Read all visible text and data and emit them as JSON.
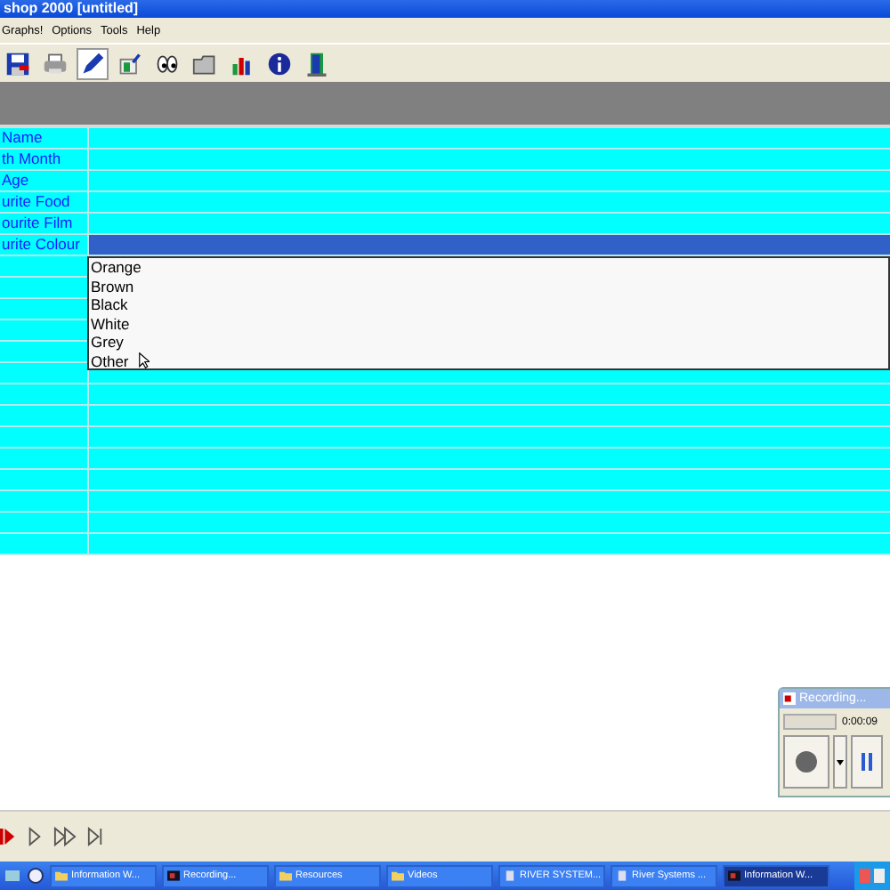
{
  "window": {
    "title": "shop 2000 [untitled]"
  },
  "menu": [
    {
      "label": "Graphs!"
    },
    {
      "label": "Options"
    },
    {
      "label": "Tools"
    },
    {
      "label": "Help"
    }
  ],
  "grid": {
    "rows": [
      {
        "label": "Name"
      },
      {
        "label": "th Month"
      },
      {
        "label": "Age"
      },
      {
        "label": "urite Food"
      },
      {
        "label": "ourite Film"
      },
      {
        "label": "urite Colour",
        "dropdown": {
          "options": [
            "Orange",
            "Brown",
            "Black",
            "White",
            "Grey",
            "Other"
          ]
        }
      }
    ]
  },
  "recorder": {
    "title": "Recording...",
    "time": "0:00:09"
  },
  "taskbar": [
    {
      "label": "Information W...",
      "selected": false,
      "kind": "folder"
    },
    {
      "label": "Recording...",
      "selected": false,
      "kind": "app"
    },
    {
      "label": "Resources",
      "selected": false,
      "kind": "folder"
    },
    {
      "label": "Videos",
      "selected": false,
      "kind": "folder"
    },
    {
      "label": "RIVER SYSTEM...",
      "selected": false,
      "kind": "doc"
    },
    {
      "label": "River Systems ...",
      "selected": false,
      "kind": "doc"
    },
    {
      "label": "Information W...",
      "selected": true,
      "kind": "app"
    }
  ]
}
